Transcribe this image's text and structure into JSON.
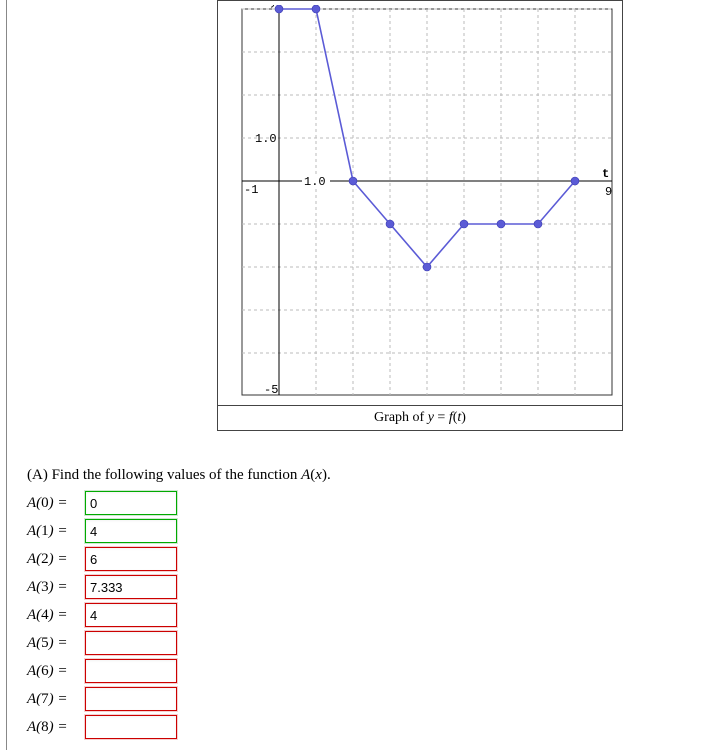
{
  "chart_data": {
    "type": "line",
    "x": [
      0,
      1,
      2,
      3,
      4,
      5,
      6,
      7,
      8
    ],
    "y": [
      4,
      4,
      0,
      -1,
      -2,
      -1,
      -1,
      -1,
      0
    ],
    "title": "",
    "xlabel": "t",
    "ylabel": "y",
    "xlim": [
      -1,
      9
    ],
    "ylim": [
      -5,
      4
    ],
    "y_tick_label_1": "1.0",
    "x_tick_label_1": "1.0",
    "x_axis_min_label": "-1",
    "y_axis_min_label": "-5",
    "x_axis_max_label": "9"
  },
  "caption": "Graph of y = f(t)",
  "prompt": "(A) Find the following values of the function A(x).",
  "fields": [
    {
      "label_func": "A",
      "label_arg": "0",
      "value": "0",
      "status": "correct"
    },
    {
      "label_func": "A",
      "label_arg": "1",
      "value": "4",
      "status": "correct"
    },
    {
      "label_func": "A",
      "label_arg": "2",
      "value": "6",
      "status": "incorrect"
    },
    {
      "label_func": "A",
      "label_arg": "3",
      "value": "7.333",
      "status": "incorrect"
    },
    {
      "label_func": "A",
      "label_arg": "4",
      "value": "4",
      "status": "incorrect"
    },
    {
      "label_func": "A",
      "label_arg": "5",
      "value": "",
      "status": "incorrect"
    },
    {
      "label_func": "A",
      "label_arg": "6",
      "value": "",
      "status": "incorrect"
    },
    {
      "label_func": "A",
      "label_arg": "7",
      "value": "",
      "status": "incorrect"
    },
    {
      "label_func": "A",
      "label_arg": "8",
      "value": "",
      "status": "incorrect"
    }
  ]
}
